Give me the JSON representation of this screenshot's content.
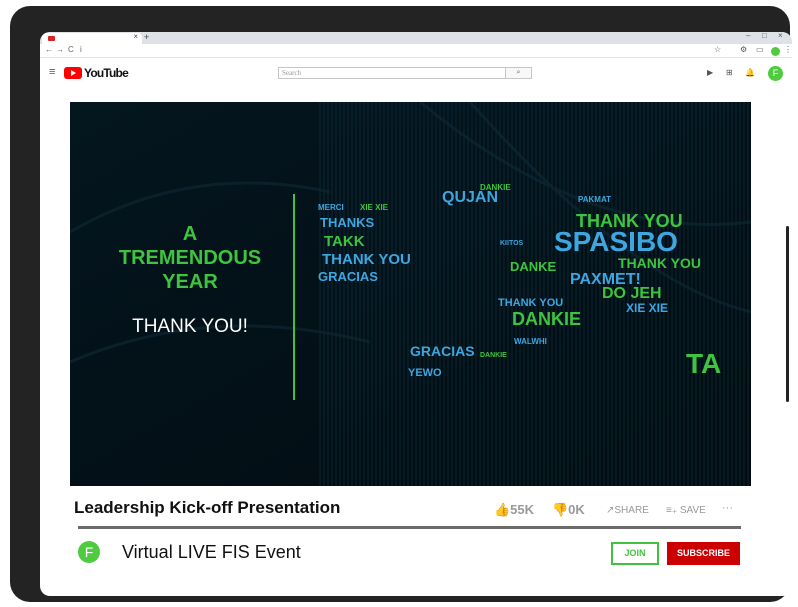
{
  "browser": {
    "tab_close": "×",
    "tab_new": "+",
    "win_min": "–",
    "win_max": "□",
    "win_close": "×",
    "nav_back": "←",
    "nav_forward": "→",
    "nav_reload": "C",
    "nav_info": "i",
    "icons": [
      "star-icon",
      "extension-icon",
      "cast-icon",
      "profile-icon",
      "menu-icon"
    ]
  },
  "youtube": {
    "wordmark": "YouTube",
    "search_placeholder": "Search",
    "search_icon": "🔍"
  },
  "slide": {
    "heading_lines": [
      "A",
      "TREMENDOUS",
      "YEAR"
    ],
    "subheading": "THANK YOU!",
    "map_words": [
      {
        "t": "QUJAN",
        "c": "#3ea6e0",
        "s": 16
      },
      {
        "t": "DANKIE",
        "c": "#3ec43e",
        "s": 8
      },
      {
        "t": "PAKMAT",
        "c": "#3ea6e0",
        "s": 8
      },
      {
        "t": "THANK YOU",
        "c": "#3ec43e",
        "s": 18
      },
      {
        "t": "SPASIBO",
        "c": "#3ea6e0",
        "s": 28
      },
      {
        "t": "THANK YOU",
        "c": "#3ec43e",
        "s": 14
      },
      {
        "t": "THANKS",
        "c": "#3ea6e0",
        "s": 13
      },
      {
        "t": "TAKK",
        "c": "#3ec43e",
        "s": 15
      },
      {
        "t": "THANK YOU",
        "c": "#3ea6e0",
        "s": 15
      },
      {
        "t": "GRACIAS",
        "c": "#3ea6e0",
        "s": 13
      },
      {
        "t": "DANKE",
        "c": "#3ec43e",
        "s": 13
      },
      {
        "t": "PAXMET!",
        "c": "#3ea6e0",
        "s": 16
      },
      {
        "t": "DO JEH",
        "c": "#3ec43e",
        "s": 16
      },
      {
        "t": "XIE XIE",
        "c": "#3ea6e0",
        "s": 12
      },
      {
        "t": "THANK YOU",
        "c": "#3ea6e0",
        "s": 11
      },
      {
        "t": "DANKIE",
        "c": "#3ec43e",
        "s": 18
      },
      {
        "t": "GRACIAS",
        "c": "#3ea6e0",
        "s": 14
      },
      {
        "t": "YEWO",
        "c": "#3ea6e0",
        "s": 11
      },
      {
        "t": "TA",
        "c": "#3ec43e",
        "s": 28
      },
      {
        "t": "MERCI",
        "c": "#3ea6e0",
        "s": 8
      },
      {
        "t": "XIE XIE",
        "c": "#3ec43e",
        "s": 8
      },
      {
        "t": "KIITOS",
        "c": "#3ea6e0",
        "s": 7
      },
      {
        "t": "WALWHI",
        "c": "#3ea6e0",
        "s": 8
      },
      {
        "t": "DANKIE",
        "c": "#3ec43e",
        "s": 7
      }
    ]
  },
  "video": {
    "title": "Leadership Kick-off Presentation",
    "likes": "👍55K",
    "dislikes": "👎0K",
    "share": "↗SHARE",
    "save": "≡₊ SAVE",
    "more": "···"
  },
  "channel": {
    "avatar_letter": "F",
    "name": "Virtual LIVE FIS Event",
    "join_label": "JOIN",
    "subscribe_label": "SUBSCRIBE"
  },
  "colors": {
    "brand_green": "#3ec43e",
    "yt_red": "#ff0000",
    "subscribe_red": "#cc0000",
    "video_bg": "#03121a",
    "map_blue": "#3ea6e0"
  }
}
